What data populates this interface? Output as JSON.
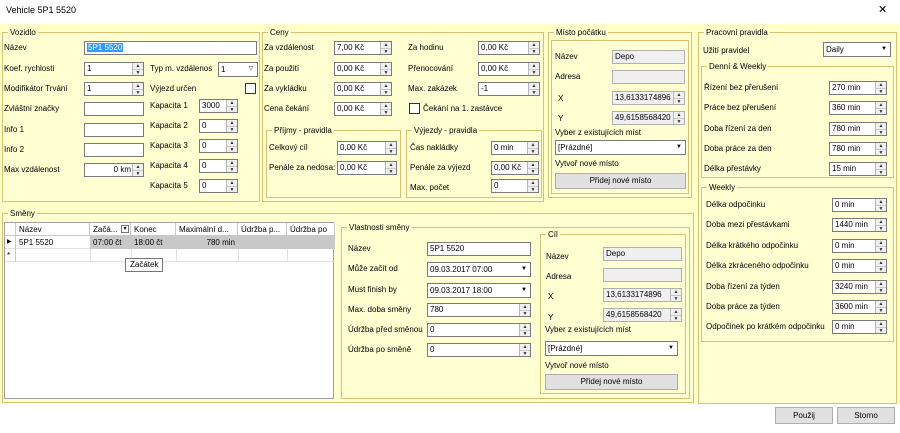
{
  "window": {
    "title": "Vehicle 5P1 5520",
    "close": "✕"
  },
  "vozidlo": {
    "legend": "Vozidlo",
    "nazev_label": "Název",
    "nazev": "5P1 5520",
    "koef_label": "Koef. rychlosti",
    "koef": "1",
    "typm_label": "Typ m. vzdálenos",
    "typm": "1",
    "modif_label": "Modifikátor Trvání",
    "modif": "1",
    "vyjezd_label": "Výjezd určen",
    "zvlastni_label": "Zvláštní značky",
    "zvlastni": "",
    "info1_label": "Info 1",
    "info1": "",
    "info2_label": "Info 2",
    "info2": "",
    "maxvzd_label": "Max vzdálenost",
    "maxvzd": "0 km",
    "kapacity": [
      {
        "label": "Kapacita 1",
        "value": "3000"
      },
      {
        "label": "Kapacita 2",
        "value": "0"
      },
      {
        "label": "Kapacita 3",
        "value": "0"
      },
      {
        "label": "Kapacita 4",
        "value": "0"
      },
      {
        "label": "Kapacita 5",
        "value": "0"
      }
    ]
  },
  "ceny": {
    "legend": "Ceny",
    "left": [
      {
        "label": "Za vzdálenost",
        "value": "7,00 Kč"
      },
      {
        "label": "Za použití",
        "value": "0,00 Kč"
      },
      {
        "label": "Za vykládku",
        "value": "0,00 Kč"
      },
      {
        "label": "Cena čekání",
        "value": "0,00 Kč"
      }
    ],
    "right": [
      {
        "label": "Za hodinu",
        "value": "0,00 Kč"
      },
      {
        "label": "Přenocování",
        "value": "0,00 Kč"
      },
      {
        "label": "Max. zakázek",
        "value": "-1"
      }
    ],
    "cekani_label": "Čekání na 1. zastávce",
    "prijmy": {
      "legend": "Příjmy - pravidla",
      "celkovy_label": "Celkový cíl",
      "celkovy": "0,00 Kč",
      "penale_label": "Penále za nedosa:",
      "penale": "0,00 Kč"
    },
    "vyjezdy": {
      "legend": "Výjezdy - pravidla",
      "cas_label": "Čas nakládky",
      "cas": "0 min",
      "penale_label": "Penále za výjezd",
      "penale": "0,00 Kč",
      "max_label": "Max. počet",
      "max": "0"
    }
  },
  "misto": {
    "legend": "Místo počátku",
    "nazev_label": "Název",
    "nazev": "Depo",
    "adresa_label": "Adresa",
    "adresa": "",
    "x_label": "X",
    "x": "13,6133174896",
    "y_label": "Y",
    "y": "49,6158568420",
    "vyber_label": "Vyber z existujících míst",
    "vyber": "[Prázdné]",
    "vytvor_label": "Vytvoř nové místo",
    "pridej": "Přidej nové místo"
  },
  "pravidla": {
    "legend": "Pracovní pravidla",
    "uziti_label": "Užití pravidel",
    "uziti": "Daily",
    "dw": {
      "legend": "Denní & Weekly",
      "rows": [
        {
          "label": "Řízení bez přerušení",
          "value": "270 min"
        },
        {
          "label": "Práce bez přerušení",
          "value": "360 min"
        },
        {
          "label": "Doba řízení za den",
          "value": "780 min"
        },
        {
          "label": "Doba práce za den",
          "value": "780 min"
        },
        {
          "label": "Délka přestávky",
          "value": "15 min"
        }
      ]
    },
    "weekly": {
      "legend": "Weekly",
      "rows": [
        {
          "label": "Délka odpočinku",
          "value": "0 min"
        },
        {
          "label": "Doba mezi přestávkami",
          "value": "1440 min"
        },
        {
          "label": "Délka krátkého odpočinku",
          "value": "0 min"
        },
        {
          "label": "Délka zkráceného odpočinku",
          "value": "0 min"
        },
        {
          "label": "Doba řízení za týden",
          "value": "3240 min"
        },
        {
          "label": "Doba práce za týden",
          "value": "3600 min"
        },
        {
          "label": "Odpočinek po krátkém odpočinku",
          "value": "0 min"
        }
      ]
    }
  },
  "smeny": {
    "legend": "Směny",
    "columns": [
      "Název",
      "Začá...",
      "Konec",
      "Maximální d...",
      "Údržba p...",
      "Údržba po"
    ],
    "rows": [
      {
        "nazev": "5P1 5520",
        "zacatek": "07:00 čt",
        "konec": "18:00 čt",
        "max": "780 min",
        "u1": "",
        "u2": ""
      }
    ],
    "new_row_marker": "*",
    "tooltip": "Začátek"
  },
  "vlastnosti": {
    "legend": "Vlastnosti směny",
    "nazev_label": "Název",
    "nazev": "5P1 5520",
    "muze_label": "Může začít od",
    "muze": "09.03.2017 07:00",
    "must_label": "Must finish by",
    "must": "09.03.2017 18:00",
    "maxdoba_label": "Max. doba směny",
    "maxdoba": "780",
    "udrzba_pred_label": "Údržba před směnou",
    "udrzba_pred": "0",
    "udrzba_po_label": "Údržba po směně",
    "udrzba_po": "0"
  },
  "cil": {
    "legend": "Cíl",
    "nazev_label": "Název",
    "nazev": "Depo",
    "adresa_label": "Adresa",
    "adresa": "",
    "x_label": "X",
    "x": "13,6133174896",
    "y_label": "Y",
    "y": "49,6158568420",
    "vyber_label": "Vyber z existujících míst",
    "vyber": "[Prázdné]",
    "vytvor_label": "Vytvoř nové místo",
    "pridej": "Přidej nové místo"
  },
  "buttons": {
    "pouzij": "Použij",
    "storno": "Storno"
  }
}
